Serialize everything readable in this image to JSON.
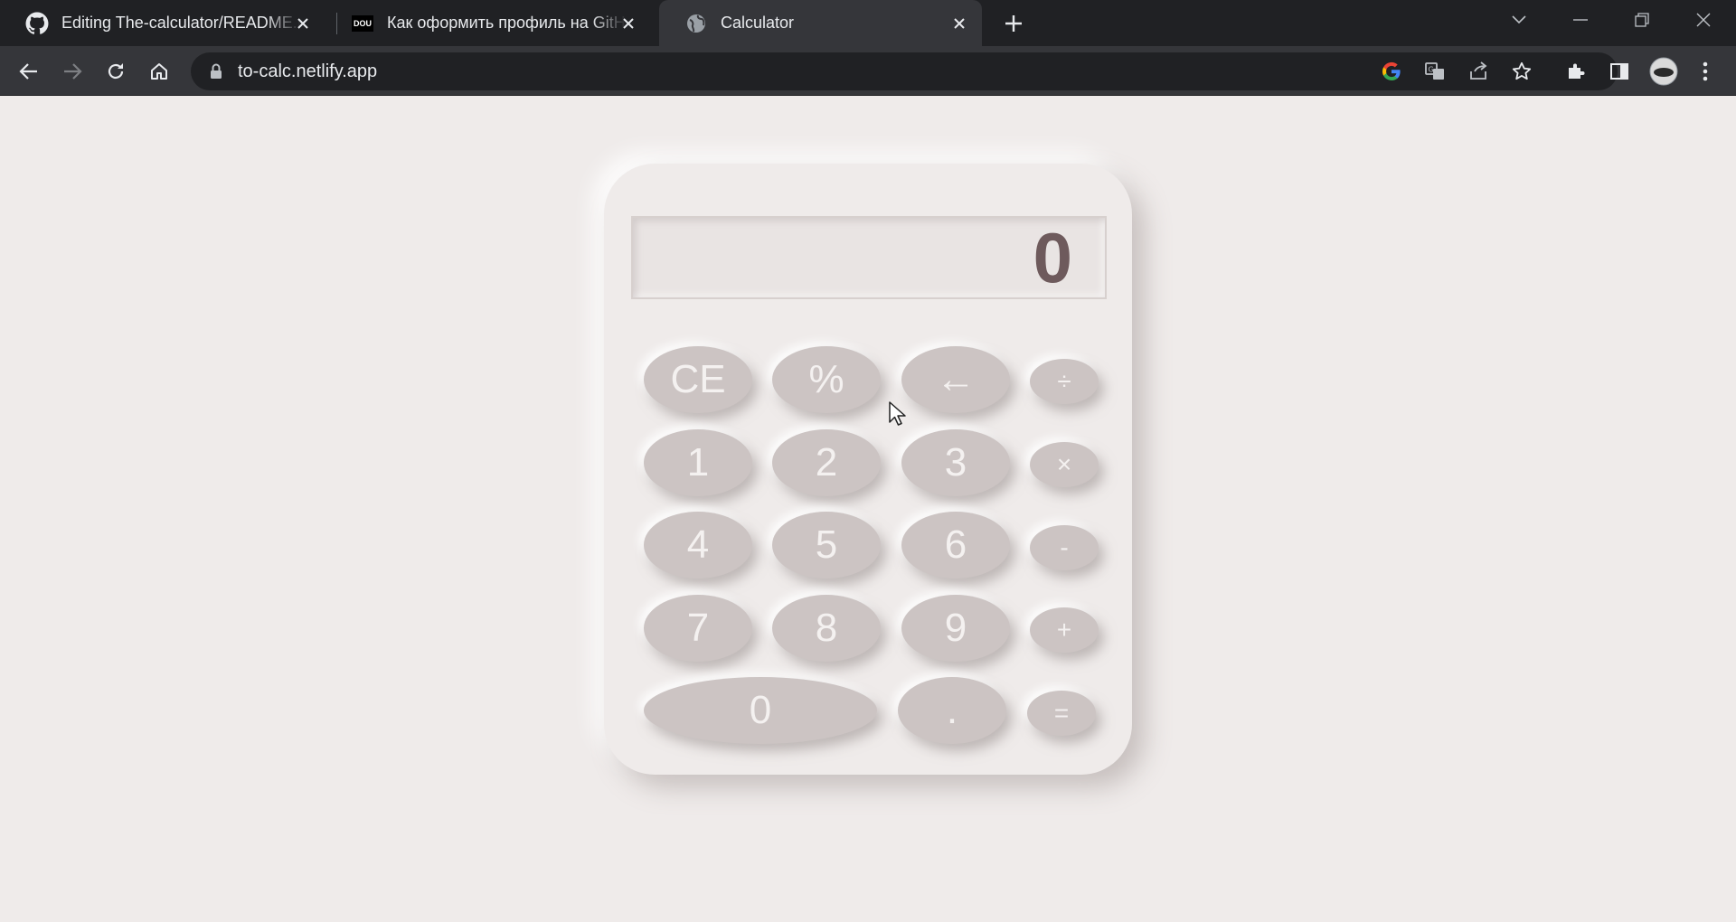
{
  "browser": {
    "tabs": [
      {
        "title": "Editing The-calculator/README.md",
        "favicon": "github-icon",
        "active": false
      },
      {
        "title": "Как оформить профиль на GitHub",
        "favicon": "dou-icon",
        "favicon_text": "DOU",
        "active": false
      },
      {
        "title": "Calculator",
        "favicon": "globe-icon",
        "active": true
      }
    ],
    "url": "to-calc.netlify.app"
  },
  "calculator": {
    "display": "0",
    "keys": {
      "clear": "CE",
      "percent": "%",
      "backspace": "←",
      "divide": "÷",
      "multiply": "×",
      "minus": "-",
      "plus": "+",
      "equals": "=",
      "decimal": ".",
      "d0": "0",
      "d1": "1",
      "d2": "2",
      "d3": "3",
      "d4": "4",
      "d5": "5",
      "d6": "6",
      "d7": "7",
      "d8": "8",
      "d9": "9"
    }
  },
  "colors": {
    "page_background": "#efebea",
    "key_fill": "#ccc4c3",
    "key_text": "#f4f1f0",
    "display_text": "#6e5a5c",
    "chrome_dark": "#202124",
    "chrome_toolbar": "#35363a"
  }
}
